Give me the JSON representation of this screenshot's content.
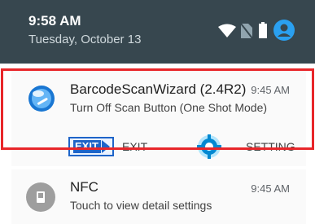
{
  "status_bar": {
    "time": "9:58 AM",
    "date": "Tuesday, October 13",
    "icons": [
      "wifi-icon",
      "no-sim-icon",
      "battery-icon",
      "account-icon"
    ]
  },
  "notification": {
    "app_name": "BarcodeScanWizard (2.4R2)",
    "time": "9:45 AM",
    "text": "Turn Off Scan Button (One Shot Mode)",
    "actions": [
      {
        "icon_text": "EXIT",
        "label": "EXIT",
        "icon": "exit-icon"
      },
      {
        "label": "SETTING",
        "icon": "gear-icon"
      }
    ],
    "highlight_color": "#e8262a"
  },
  "nfc_notification": {
    "title": "NFC",
    "time": "9:45 AM",
    "text": "Touch to view detail settings",
    "icon": "nfc-icon"
  },
  "colors": {
    "status_bar_bg": "#37474f",
    "accent": "#1e64c8"
  }
}
